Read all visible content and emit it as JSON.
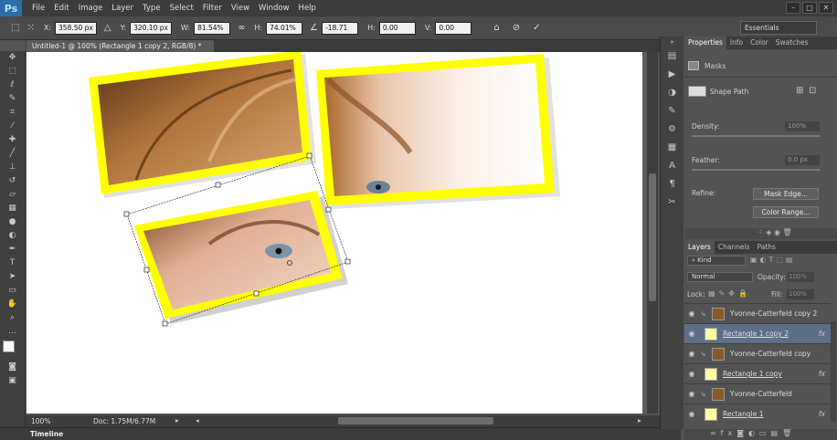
{
  "menu": {
    "logo": "Ps",
    "items": [
      "File",
      "Edit",
      "Image",
      "Layer",
      "Type",
      "Select",
      "Filter",
      "View",
      "Window",
      "Help"
    ]
  },
  "window_controls": [
    "–",
    "□",
    "✕"
  ],
  "options": {
    "x_label": "X:",
    "x_value": "358.50 px",
    "y_label": "Y:",
    "y_value": "320.10 px",
    "w_label": "W:",
    "w_value": "81.54%",
    "h_label": "H:",
    "h_value": "74.01%",
    "angle_value": "-18.71",
    "hskew_label": "H:",
    "hskew_value": "0.00",
    "vskew_label": "V:",
    "vskew_value": "0.00",
    "workspace": "Essentials"
  },
  "document_tab": "Untitled-1 @ 100% (Rectangle 1 copy 2, RGB/8) *",
  "status": {
    "zoom": "100%",
    "doc": "Doc: 1.75M/6.77M"
  },
  "timeline_label": "Timeline",
  "properties": {
    "tabs": [
      "Properties",
      "Info",
      "Color",
      "Swatches"
    ],
    "section": "Masks",
    "shape_path": "Shape Path",
    "density_label": "Density:",
    "density_value": "100%",
    "feather_label": "Feather:",
    "feather_value": "0.0 px",
    "refine_label": "Refine:",
    "mask_edge_btn": "Mask Edge...",
    "color_range_btn": "Color Range..."
  },
  "layers": {
    "tabs": [
      "Layers",
      "Channels",
      "Paths"
    ],
    "kind": "Kind",
    "blend_mode": "Normal",
    "opacity_label": "Opacity:",
    "opacity_value": "100%",
    "lock_label": "Lock:",
    "fill_label": "Fill:",
    "fill_value": "100%",
    "items": [
      {
        "name": "Yvonne-Catterfeld copy 2",
        "type": "photo",
        "fx": ""
      },
      {
        "name": "Rectangle 1 copy 2",
        "type": "shape",
        "fx": "fx"
      },
      {
        "name": "Yvonne-Catterfeld copy",
        "type": "photo",
        "fx": ""
      },
      {
        "name": "Rectangle 1 copy",
        "type": "shape",
        "fx": "fx"
      },
      {
        "name": "Yvonne-Catterfeld",
        "type": "photo",
        "fx": ""
      },
      {
        "name": "Rectangle 1",
        "type": "shape",
        "fx": "fx"
      }
    ]
  },
  "colors": {
    "frame": "#ffff00",
    "selection": "#5b6f89"
  }
}
